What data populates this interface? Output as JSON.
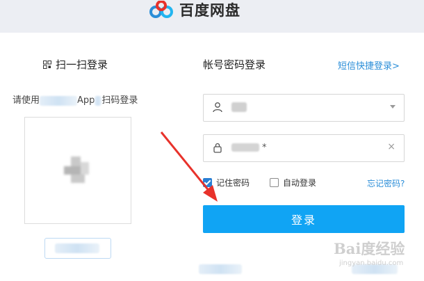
{
  "header": {
    "logo_text": "百度网盘",
    "bg": "#eceef3"
  },
  "qr_panel": {
    "title": "扫一扫登录",
    "hint_prefix": "请使用",
    "hint_mid": "App",
    "hint_suffix": "扫码登录"
  },
  "account_panel": {
    "title": "帐号密码登录",
    "sms_link": "短信快捷登录>",
    "username_value": "",
    "password_mask": "*",
    "remember_label": "记住密码",
    "remember_checked": true,
    "auto_label": "自动登录",
    "auto_checked": false,
    "forgot_label": "忘记密码?",
    "login_label": "登录"
  },
  "watermark": {
    "brand": "Bai度经验",
    "sub": "jingyan.baidu.com"
  },
  "colors": {
    "accent": "#10a4f4",
    "link": "#2b8ed8",
    "arrow": "#e8322b"
  }
}
